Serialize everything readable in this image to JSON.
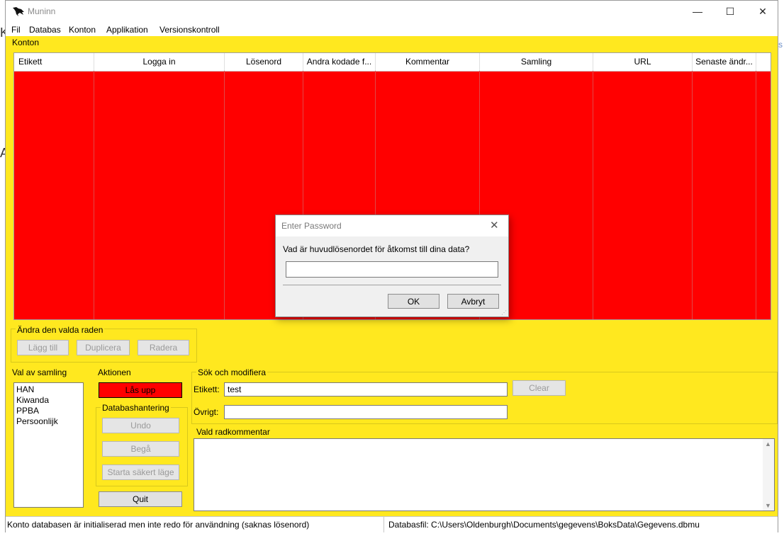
{
  "window": {
    "title": "Muninn",
    "minimize": "—",
    "maximize": "☐",
    "close": "✕"
  },
  "menu": [
    "Fil",
    "Databas",
    "Konton",
    "Applikation",
    "Versionskontroll"
  ],
  "accounts": {
    "group_label": "Konton",
    "columns": [
      "Etikett",
      "Logga in",
      "Lösenord",
      "Andra kodade f...",
      "Kommentar",
      "Samling",
      "URL",
      "Senaste ändr..."
    ]
  },
  "edit_row": {
    "label": "Ändra den valda raden",
    "add": "Lägg till",
    "duplicate": "Duplicera",
    "delete": "Radera"
  },
  "collections": {
    "label": "Val av samling",
    "items": [
      "HAN",
      "Kiwanda",
      "PPBA",
      "Persoonlijk"
    ]
  },
  "actions": {
    "label": "Aktionen",
    "unlock": "Lås upp",
    "db_label": "Databashantering",
    "undo": "Undo",
    "commit": "Begå",
    "safe_mode": "Starta säkert läge",
    "quit": "Quit"
  },
  "search": {
    "label": "Sök och modifiera",
    "tag_label": "Etikett:",
    "tag_value": "test",
    "clear": "Clear",
    "other_label": "Övrigt:",
    "other_value": ""
  },
  "comment": {
    "label": "Vald radkommentar"
  },
  "status": {
    "left": "Konto databasen är initialiserad men inte redo för användning (saknas lösenord)",
    "right": "Databasfil: C:\\Users\\Oldenburgh\\Documents\\gegevens\\BoksData\\Gegevens.dbmu"
  },
  "dialog": {
    "title": "Enter Password",
    "prompt": "Vad är huvudlösenordet för åtkomst till dina data?",
    "password_value": "",
    "ok": "OK",
    "cancel": "Avbryt",
    "close": "✕"
  },
  "colors": {
    "main_bg": "#ffe81f",
    "table_bg": "#ff0000",
    "unlock_bg": "#ff0000"
  }
}
